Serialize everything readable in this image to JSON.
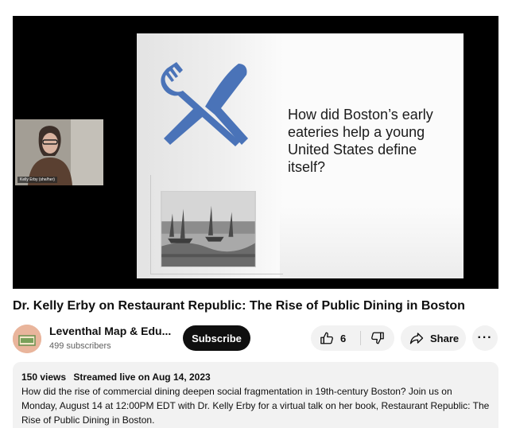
{
  "video": {
    "slide": {
      "question": "How did Boston’s early eateries help a young United States define itself?",
      "accent_color": "#4a73b8"
    },
    "speaker_caption": "Kelly Erby (she/her)"
  },
  "title": "Dr. Kelly Erby on Restaurant Republic: The Rise of Public Dining in Boston",
  "channel": {
    "name": "Leventhal Map & Edu...",
    "subscribers": "499 subscribers",
    "subscribe_label": "Subscribe"
  },
  "actions": {
    "like_count": "6",
    "share_label": "Share",
    "more_label": "···"
  },
  "description": {
    "views": "150 views",
    "streamed": "Streamed live on Aug 14, 2023",
    "text": "How did the rise of commercial dining deepen social fragmentation in 19th-century Boston? Join us on Monday, August 14 at 12:00PM EDT with Dr. Kelly Erby for a virtual talk on her book, Restaurant Republic: The Rise of Public Dining in Boston."
  },
  "icons": [
    "thumbs-up-icon",
    "thumbs-down-icon",
    "share-icon",
    "more-icon",
    "fork-icon",
    "knife-icon",
    "compass-icon"
  ]
}
